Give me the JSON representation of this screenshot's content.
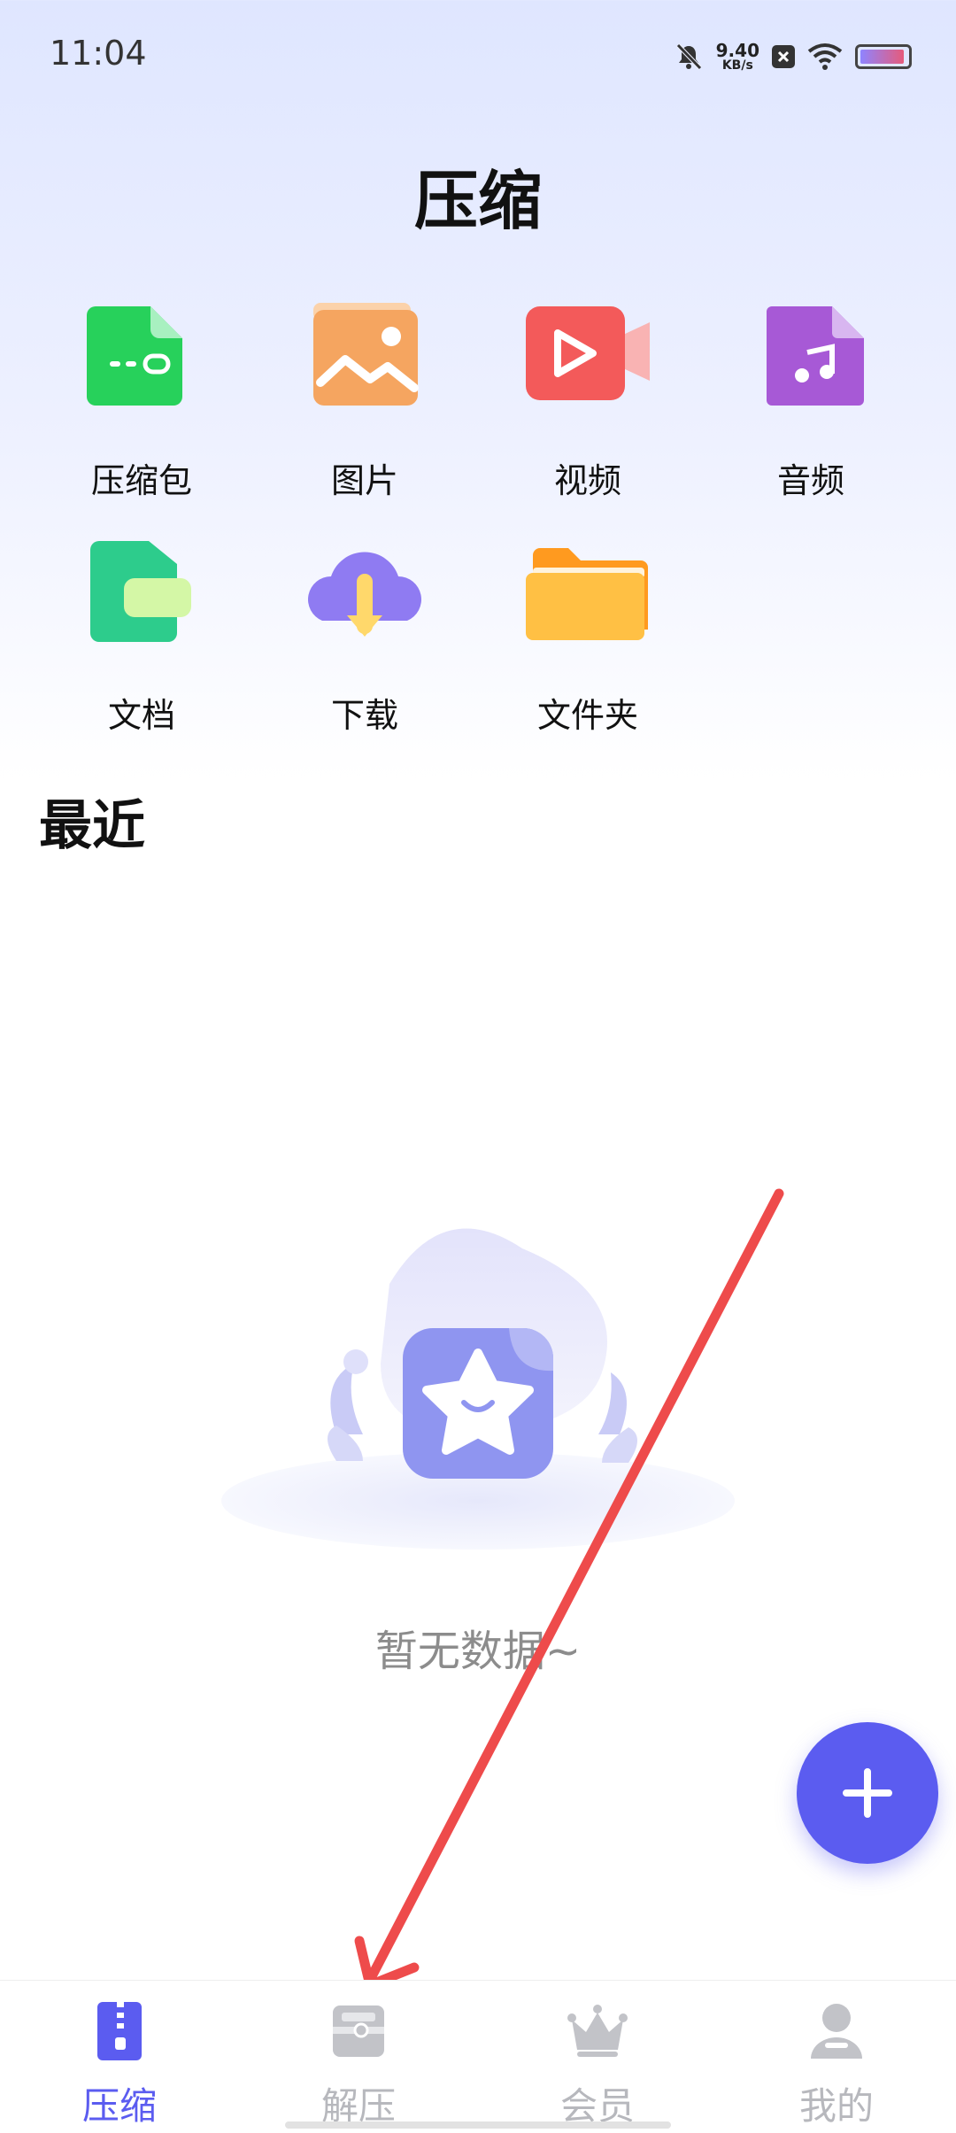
{
  "status_bar": {
    "time": "11:04",
    "net_speed": "9.40",
    "net_unit": "KB/s",
    "battery_percent": 95
  },
  "header": {
    "title": "压缩"
  },
  "categories": [
    {
      "label": "压缩包",
      "icon": "zip-file-icon",
      "color": "#27d15b"
    },
    {
      "label": "图片",
      "icon": "image-icon",
      "color": "#f5a560"
    },
    {
      "label": "视频",
      "icon": "video-icon",
      "color": "#f35a5a"
    },
    {
      "label": "音频",
      "icon": "music-file-icon",
      "color": "#a759d6"
    },
    {
      "label": "文档",
      "icon": "document-icon",
      "color": "#2dcc8c"
    },
    {
      "label": "下载",
      "icon": "cloud-download-icon",
      "color": "#8f7bf2"
    },
    {
      "label": "文件夹",
      "icon": "folder-icon",
      "color": "#ffb23a"
    }
  ],
  "recent": {
    "title": "最近",
    "empty_text": "暂无数据~"
  },
  "fab": {
    "icon": "plus-icon",
    "color": "#5b5cf0"
  },
  "tabs": [
    {
      "label": "压缩",
      "icon": "zip-tab-icon",
      "active": true
    },
    {
      "label": "解压",
      "icon": "unzip-tab-icon",
      "active": false
    },
    {
      "label": "会员",
      "icon": "crown-icon",
      "active": false
    },
    {
      "label": "我的",
      "icon": "user-icon",
      "active": false
    }
  ],
  "colors": {
    "accent": "#5b5cf0",
    "inactive_tab": "#b7b8bd",
    "annotation_arrow": "#ee4b4b"
  }
}
